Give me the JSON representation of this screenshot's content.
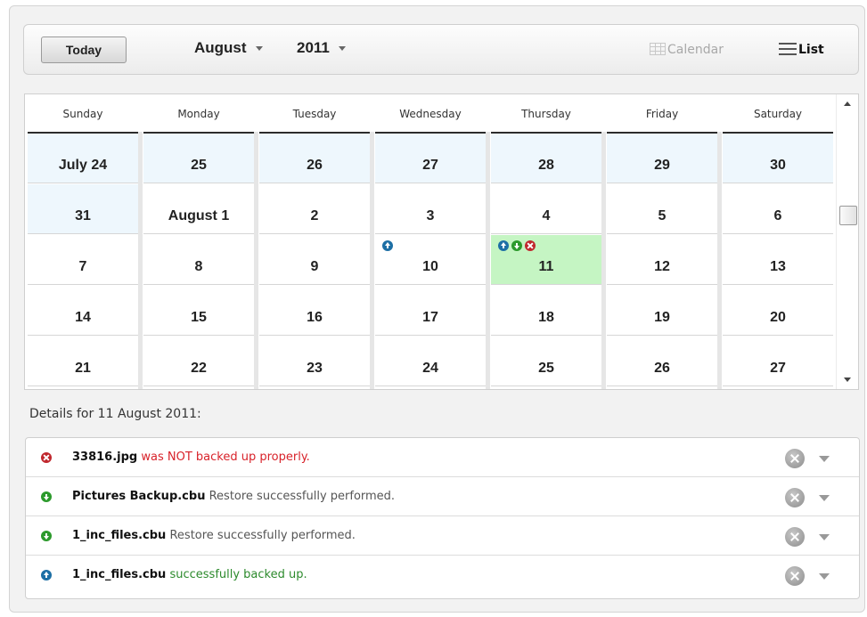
{
  "toolbar": {
    "today_label": "Today",
    "month": "August",
    "year": "2011",
    "calendar_label": "Calendar",
    "list_label": "List"
  },
  "calendar": {
    "weekdays": [
      "Sunday",
      "Monday",
      "Tuesday",
      "Wednesday",
      "Thursday",
      "Friday",
      "Saturday"
    ],
    "weeks": [
      [
        {
          "label": "July 24",
          "prev": true
        },
        {
          "label": "25",
          "prev": true
        },
        {
          "label": "26",
          "prev": true
        },
        {
          "label": "27",
          "prev": true
        },
        {
          "label": "28",
          "prev": true
        },
        {
          "label": "29",
          "prev": true
        },
        {
          "label": "30",
          "prev": true
        }
      ],
      [
        {
          "label": "31",
          "prev": true
        },
        {
          "label": "August 1"
        },
        {
          "label": "2"
        },
        {
          "label": "3"
        },
        {
          "label": "4"
        },
        {
          "label": "5"
        },
        {
          "label": "6"
        }
      ],
      [
        {
          "label": "7"
        },
        {
          "label": "8"
        },
        {
          "label": "9"
        },
        {
          "label": "10",
          "icons": [
            "backup-up-icon"
          ]
        },
        {
          "label": "11",
          "selected": true,
          "icons": [
            "backup-up-icon",
            "restore-down-icon",
            "error-icon"
          ]
        },
        {
          "label": "12"
        },
        {
          "label": "13"
        }
      ],
      [
        {
          "label": "14"
        },
        {
          "label": "15"
        },
        {
          "label": "16"
        },
        {
          "label": "17"
        },
        {
          "label": "18"
        },
        {
          "label": "19"
        },
        {
          "label": "20"
        }
      ],
      [
        {
          "label": "21"
        },
        {
          "label": "22"
        },
        {
          "label": "23"
        },
        {
          "label": "24"
        },
        {
          "label": "25"
        },
        {
          "label": "26"
        },
        {
          "label": "27"
        }
      ]
    ]
  },
  "details": {
    "title": "Details for 11 August 2011:",
    "items": [
      {
        "icon": "error-icon",
        "file": "33816.jpg",
        "message": "was NOT backed up properly.",
        "tone": "error"
      },
      {
        "icon": "restore-down-icon",
        "file": "Pictures Backup.cbu",
        "message": "Restore successfully performed.",
        "tone": "neutral"
      },
      {
        "icon": "restore-down-icon",
        "file": "1_inc_files.cbu",
        "message": "Restore successfully performed.",
        "tone": "neutral"
      },
      {
        "icon": "backup-up-icon",
        "file": "1_inc_files.cbu",
        "message": "successfully backed up.",
        "tone": "success"
      }
    ]
  },
  "colors": {
    "selected_day": "#c5f5c3",
    "previous_month_day": "#eef7fd",
    "error_text": "#d8222a",
    "success_text": "#2c8a2c",
    "backup_icon": "#1d6fa5",
    "restore_icon": "#2c9a2c",
    "error_icon": "#c0272d"
  }
}
